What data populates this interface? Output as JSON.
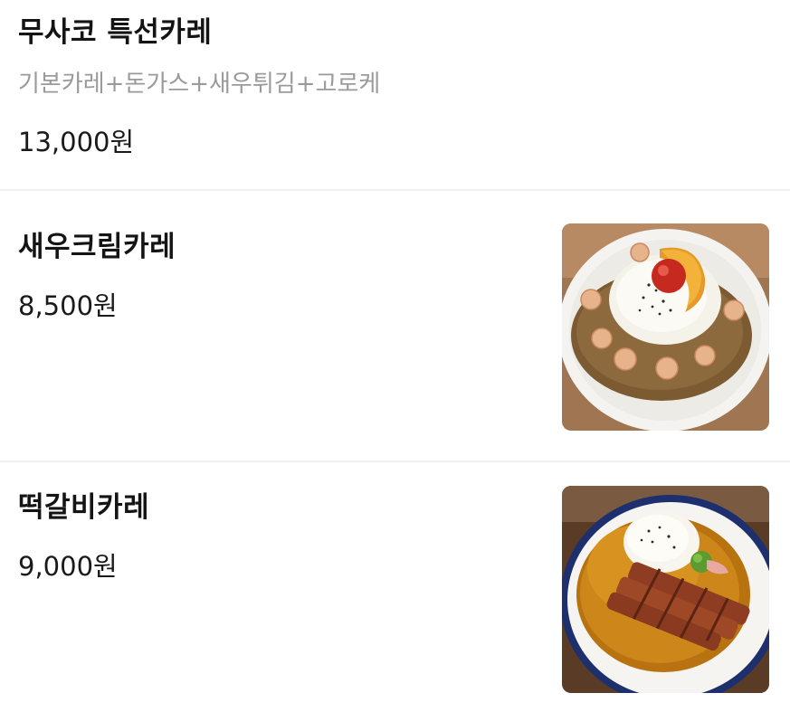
{
  "menu": {
    "items": [
      {
        "name": "무사코 특선카레",
        "description": "기본카레+돈가스+새우튀김+고로케",
        "price": "13,000원"
      },
      {
        "name": "새우크림카레",
        "price": "8,500원",
        "image": "shrimp-cream-curry-photo"
      },
      {
        "name": "떡갈비카레",
        "price": "9,000원",
        "image": "tteokgalbi-curry-photo"
      }
    ]
  }
}
